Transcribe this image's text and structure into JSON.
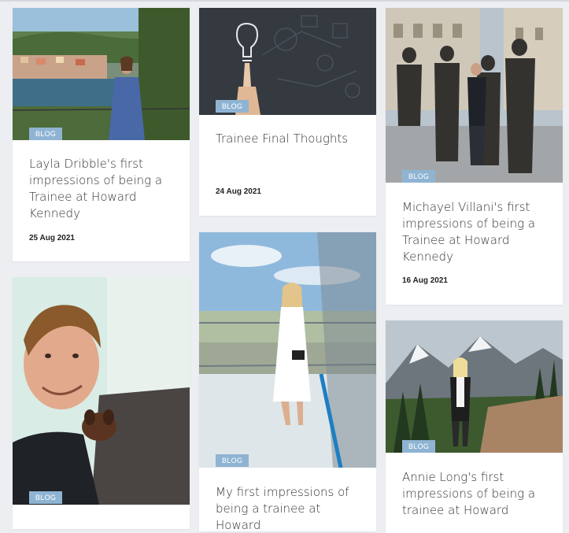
{
  "cards": [
    {
      "badge": "BLOG",
      "title": "Layla Dribble's first impressions of being a Trainee at Howard Kennedy",
      "date": "25 Aug 2021",
      "image": "woman-in-blue-dress-portofino-harbour"
    },
    {
      "badge": "BLOG",
      "title": "Trainee Final Thoughts",
      "date": "24 Aug 2021",
      "image": "hand-holding-lightbulb-drawing"
    },
    {
      "badge": "BLOG",
      "title": "Michayel Villani's first impressions of being a Trainee at Howard Kennedy",
      "date": "16 Aug 2021",
      "image": "man-with-beatles-statues"
    },
    {
      "badge": "BLOG",
      "title": "",
      "date": "",
      "image": "man-selfie-with-dachshund"
    },
    {
      "badge": "BLOG",
      "title": "My first impressions of being a trainee at Howard",
      "date": "",
      "image": "woman-in-white-dress-observation-deck"
    },
    {
      "badge": "BLOG",
      "title": "Annie Long's first impressions of being a trainee at Howard",
      "date": "",
      "image": "woman-hiking-mountains"
    }
  ]
}
